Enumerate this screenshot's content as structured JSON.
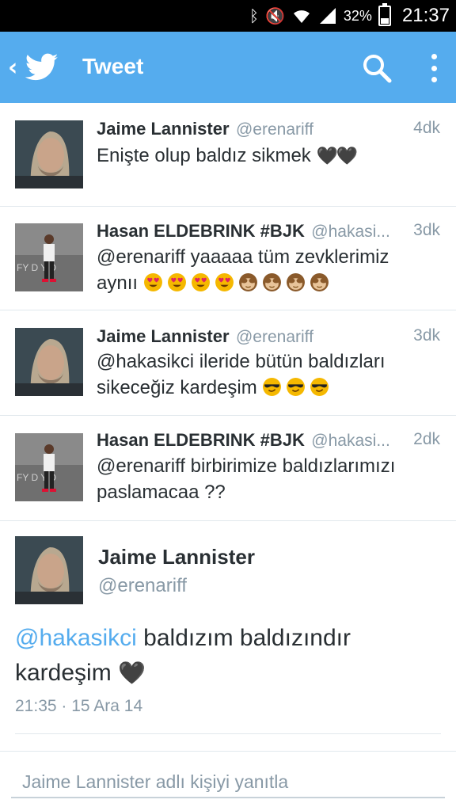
{
  "status_bar": {
    "battery_percent": "32%",
    "battery_level": 0.32,
    "time": "21:37",
    "icons": [
      "bluetooth-icon",
      "mute-icon",
      "wifi-icon",
      "signal-icon",
      "battery-icon"
    ]
  },
  "action_bar": {
    "title": "Tweet",
    "icons": [
      "back-icon",
      "twitter-bird-icon",
      "search-icon",
      "overflow-menu-icon"
    ],
    "color": "#55acee"
  },
  "tweets": [
    {
      "name": "Jaime Lannister",
      "handle": "@erenariff",
      "time": "4dk",
      "text": "Enişte olup baldız sikmek",
      "suffix": "🖤🖤",
      "avatar": "jaime-avatar"
    },
    {
      "name": "Hasan ELDEBRINK #BJK",
      "handle": "@hakasi...",
      "time": "3dk",
      "text": "@erenariff yaaaaa tüm zevklerimiz aynıı",
      "emoji": [
        "heart-eyes",
        "heart-eyes",
        "heart-eyes",
        "heart-eyes",
        "see-no-evil-monkey",
        "see-no-evil-monkey",
        "see-no-evil-monkey",
        "see-no-evil-monkey"
      ],
      "avatar": "hasan-avatar"
    },
    {
      "name": "Jaime Lannister",
      "handle": "@erenariff",
      "time": "3dk",
      "text": "@hakasikci ileride bütün baldızları sikeceğiz kardeşim",
      "emoji": [
        "sunglasses-face",
        "sunglasses-face",
        "sunglasses-face"
      ],
      "avatar": "jaime-avatar"
    },
    {
      "name": "Hasan ELDEBRINK #BJK",
      "handle": "@hakasi...",
      "time": "2dk",
      "text": "@erenariff birbirimize baldızlarımızı paslamacaa ??",
      "avatar": "hasan-avatar"
    }
  ],
  "detail": {
    "name": "Jaime Lannister",
    "handle": "@erenariff",
    "mention": "@hakasikci",
    "text": " baldızım baldızındır kardeşim",
    "suffix": "🖤",
    "meta": "21:35 · 15 Ara 14"
  },
  "reply": {
    "placeholder": "Jaime Lannister adlı kişiyi yanıtla"
  }
}
